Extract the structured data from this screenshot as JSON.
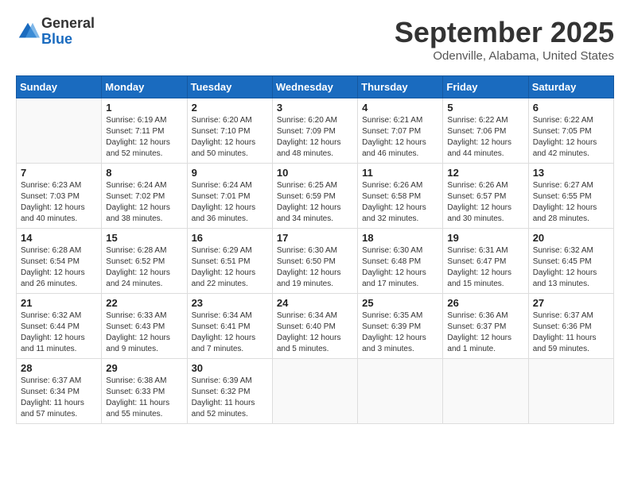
{
  "logo": {
    "general": "General",
    "blue": "Blue"
  },
  "title": "September 2025",
  "location": "Odenville, Alabama, United States",
  "weekdays": [
    "Sunday",
    "Monday",
    "Tuesday",
    "Wednesday",
    "Thursday",
    "Friday",
    "Saturday"
  ],
  "weeks": [
    [
      {
        "day": "",
        "sunrise": "",
        "sunset": "",
        "daylight": ""
      },
      {
        "day": "1",
        "sunrise": "Sunrise: 6:19 AM",
        "sunset": "Sunset: 7:11 PM",
        "daylight": "Daylight: 12 hours and 52 minutes."
      },
      {
        "day": "2",
        "sunrise": "Sunrise: 6:20 AM",
        "sunset": "Sunset: 7:10 PM",
        "daylight": "Daylight: 12 hours and 50 minutes."
      },
      {
        "day": "3",
        "sunrise": "Sunrise: 6:20 AM",
        "sunset": "Sunset: 7:09 PM",
        "daylight": "Daylight: 12 hours and 48 minutes."
      },
      {
        "day": "4",
        "sunrise": "Sunrise: 6:21 AM",
        "sunset": "Sunset: 7:07 PM",
        "daylight": "Daylight: 12 hours and 46 minutes."
      },
      {
        "day": "5",
        "sunrise": "Sunrise: 6:22 AM",
        "sunset": "Sunset: 7:06 PM",
        "daylight": "Daylight: 12 hours and 44 minutes."
      },
      {
        "day": "6",
        "sunrise": "Sunrise: 6:22 AM",
        "sunset": "Sunset: 7:05 PM",
        "daylight": "Daylight: 12 hours and 42 minutes."
      }
    ],
    [
      {
        "day": "7",
        "sunrise": "Sunrise: 6:23 AM",
        "sunset": "Sunset: 7:03 PM",
        "daylight": "Daylight: 12 hours and 40 minutes."
      },
      {
        "day": "8",
        "sunrise": "Sunrise: 6:24 AM",
        "sunset": "Sunset: 7:02 PM",
        "daylight": "Daylight: 12 hours and 38 minutes."
      },
      {
        "day": "9",
        "sunrise": "Sunrise: 6:24 AM",
        "sunset": "Sunset: 7:01 PM",
        "daylight": "Daylight: 12 hours and 36 minutes."
      },
      {
        "day": "10",
        "sunrise": "Sunrise: 6:25 AM",
        "sunset": "Sunset: 6:59 PM",
        "daylight": "Daylight: 12 hours and 34 minutes."
      },
      {
        "day": "11",
        "sunrise": "Sunrise: 6:26 AM",
        "sunset": "Sunset: 6:58 PM",
        "daylight": "Daylight: 12 hours and 32 minutes."
      },
      {
        "day": "12",
        "sunrise": "Sunrise: 6:26 AM",
        "sunset": "Sunset: 6:57 PM",
        "daylight": "Daylight: 12 hours and 30 minutes."
      },
      {
        "day": "13",
        "sunrise": "Sunrise: 6:27 AM",
        "sunset": "Sunset: 6:55 PM",
        "daylight": "Daylight: 12 hours and 28 minutes."
      }
    ],
    [
      {
        "day": "14",
        "sunrise": "Sunrise: 6:28 AM",
        "sunset": "Sunset: 6:54 PM",
        "daylight": "Daylight: 12 hours and 26 minutes."
      },
      {
        "day": "15",
        "sunrise": "Sunrise: 6:28 AM",
        "sunset": "Sunset: 6:52 PM",
        "daylight": "Daylight: 12 hours and 24 minutes."
      },
      {
        "day": "16",
        "sunrise": "Sunrise: 6:29 AM",
        "sunset": "Sunset: 6:51 PM",
        "daylight": "Daylight: 12 hours and 22 minutes."
      },
      {
        "day": "17",
        "sunrise": "Sunrise: 6:30 AM",
        "sunset": "Sunset: 6:50 PM",
        "daylight": "Daylight: 12 hours and 19 minutes."
      },
      {
        "day": "18",
        "sunrise": "Sunrise: 6:30 AM",
        "sunset": "Sunset: 6:48 PM",
        "daylight": "Daylight: 12 hours and 17 minutes."
      },
      {
        "day": "19",
        "sunrise": "Sunrise: 6:31 AM",
        "sunset": "Sunset: 6:47 PM",
        "daylight": "Daylight: 12 hours and 15 minutes."
      },
      {
        "day": "20",
        "sunrise": "Sunrise: 6:32 AM",
        "sunset": "Sunset: 6:45 PM",
        "daylight": "Daylight: 12 hours and 13 minutes."
      }
    ],
    [
      {
        "day": "21",
        "sunrise": "Sunrise: 6:32 AM",
        "sunset": "Sunset: 6:44 PM",
        "daylight": "Daylight: 12 hours and 11 minutes."
      },
      {
        "day": "22",
        "sunrise": "Sunrise: 6:33 AM",
        "sunset": "Sunset: 6:43 PM",
        "daylight": "Daylight: 12 hours and 9 minutes."
      },
      {
        "day": "23",
        "sunrise": "Sunrise: 6:34 AM",
        "sunset": "Sunset: 6:41 PM",
        "daylight": "Daylight: 12 hours and 7 minutes."
      },
      {
        "day": "24",
        "sunrise": "Sunrise: 6:34 AM",
        "sunset": "Sunset: 6:40 PM",
        "daylight": "Daylight: 12 hours and 5 minutes."
      },
      {
        "day": "25",
        "sunrise": "Sunrise: 6:35 AM",
        "sunset": "Sunset: 6:39 PM",
        "daylight": "Daylight: 12 hours and 3 minutes."
      },
      {
        "day": "26",
        "sunrise": "Sunrise: 6:36 AM",
        "sunset": "Sunset: 6:37 PM",
        "daylight": "Daylight: 12 hours and 1 minute."
      },
      {
        "day": "27",
        "sunrise": "Sunrise: 6:37 AM",
        "sunset": "Sunset: 6:36 PM",
        "daylight": "Daylight: 11 hours and 59 minutes."
      }
    ],
    [
      {
        "day": "28",
        "sunrise": "Sunrise: 6:37 AM",
        "sunset": "Sunset: 6:34 PM",
        "daylight": "Daylight: 11 hours and 57 minutes."
      },
      {
        "day": "29",
        "sunrise": "Sunrise: 6:38 AM",
        "sunset": "Sunset: 6:33 PM",
        "daylight": "Daylight: 11 hours and 55 minutes."
      },
      {
        "day": "30",
        "sunrise": "Sunrise: 6:39 AM",
        "sunset": "Sunset: 6:32 PM",
        "daylight": "Daylight: 11 hours and 52 minutes."
      },
      {
        "day": "",
        "sunrise": "",
        "sunset": "",
        "daylight": ""
      },
      {
        "day": "",
        "sunrise": "",
        "sunset": "",
        "daylight": ""
      },
      {
        "day": "",
        "sunrise": "",
        "sunset": "",
        "daylight": ""
      },
      {
        "day": "",
        "sunrise": "",
        "sunset": "",
        "daylight": ""
      }
    ]
  ]
}
